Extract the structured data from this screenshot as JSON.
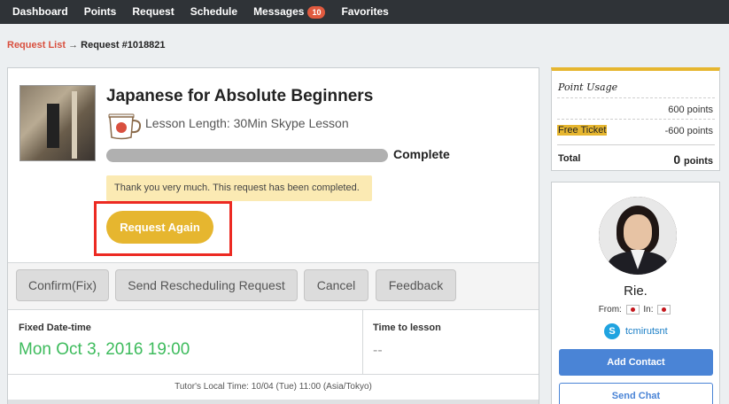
{
  "nav": {
    "items": [
      {
        "label": "Dashboard"
      },
      {
        "label": "Points"
      },
      {
        "label": "Request"
      },
      {
        "label": "Schedule"
      },
      {
        "label": "Messages",
        "badge": "10"
      },
      {
        "label": "Favorites"
      }
    ]
  },
  "breadcrumb": {
    "link": "Request List",
    "arrow": "→",
    "current": "Request #1018821"
  },
  "lesson": {
    "title": "Japanese for Absolute Beginners",
    "length": "Lesson Length: 30Min Skype Lesson",
    "status": "Complete",
    "progress_percent": 100,
    "notice": "Thank you very much. This request has been completed.",
    "request_again": "Request Again",
    "icon": "coffee-cup-icon"
  },
  "actions": [
    {
      "label": "Confirm(Fix)"
    },
    {
      "label": "Send Rescheduling Request"
    },
    {
      "label": "Cancel"
    },
    {
      "label": "Feedback"
    }
  ],
  "schedule": {
    "fixed_label": "Fixed Date-time",
    "fixed_value": "Mon Oct 3, 2016 19:00",
    "time_to_label": "Time to lesson",
    "time_to_value": "--",
    "local_time": "Tutor's Local Time: 10/04 (Tue) 11:00 (Asia/Tokyo)"
  },
  "points": {
    "title": "Point Usage",
    "amount": "600 points",
    "free_ticket_label": "Free Ticket",
    "free_ticket_value": "-600 points",
    "total_label": "Total",
    "total_value": "0",
    "total_unit": "points"
  },
  "tutor": {
    "name": "Rie.",
    "from_label": "From:",
    "in_label": "In:",
    "skype_id": "tcmirutsnt",
    "add_contact": "Add Contact",
    "send_chat": "Send Chat"
  },
  "colors": {
    "accent": "#e6b62f",
    "link": "#d9503f",
    "date_green": "#3dbb5c",
    "highlight_red": "#ec2a22",
    "primary_blue": "#4a84d6"
  }
}
